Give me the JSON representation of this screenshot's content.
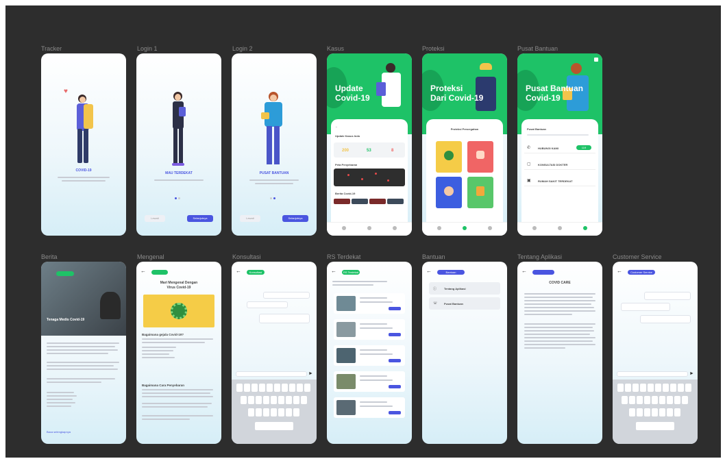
{
  "frames": [
    {
      "id": "tracker",
      "label": "Tracker"
    },
    {
      "id": "login1",
      "label": "Login 1"
    },
    {
      "id": "login2",
      "label": "Login 2"
    },
    {
      "id": "kasus",
      "label": "Kasus"
    },
    {
      "id": "proteksi",
      "label": "Proteksi"
    },
    {
      "id": "pusat-bantuan",
      "label": "Pusat Bantuan"
    },
    {
      "id": "berita",
      "label": "Berita"
    },
    {
      "id": "mengenal",
      "label": "Mengenal"
    },
    {
      "id": "konsultasi",
      "label": "Konsultasi"
    },
    {
      "id": "rs-terdekat",
      "label": "RS Terdekat"
    },
    {
      "id": "bantuan",
      "label": "Bantuan"
    },
    {
      "id": "tentang-aplikasi",
      "label": "Tentang Aplikasi"
    },
    {
      "id": "customer-service",
      "label": "Customer Service"
    }
  ],
  "onboarding": {
    "tracker_title": "COVID-19",
    "login1_title": "MAU TERDEKAT",
    "login2_title": "PUSAT BANTUAN",
    "login_next": "Selanjutnya",
    "login_skip": "Lewati"
  },
  "kasus": {
    "hero": [
      "Update",
      "Covid-19"
    ],
    "stats": [
      "200",
      "53",
      "8"
    ],
    "section1": "Update Kasus Indo",
    "section2": "Peta Penyebaran",
    "section3": "Berita Covid-19"
  },
  "proteksi": {
    "hero": [
      "Proteksi",
      "Dari Covid-19"
    ],
    "card_title": "Proteksi Pencegahan"
  },
  "pusat": {
    "hero": [
      "Pusat Bantuan",
      "Covid-19"
    ],
    "card_title": "Pusat Bantuan",
    "items": [
      "HUBUNGI KAMI",
      "KONSULTASI DOKTER",
      "RUMAH SAKIT TERDEKAT"
    ],
    "hotline": "119"
  },
  "berita": {
    "headline": "Tenaga Medis Covid-19",
    "read_more": "Baca selengkapnya"
  },
  "mengenal": {
    "title": [
      "Mari Mengenal Dengan",
      "Virus Covid-19"
    ],
    "q1": "Bagaimana gejala Covid-19?",
    "q2": "Bagaimana Cara Penyebaran"
  },
  "konsultasi": {
    "badge": "Konsultasi"
  },
  "rs": {
    "badge": "RS Terdekat"
  },
  "bantuan": {
    "badge": "Bantuan",
    "items": [
      "Tentang Aplikasi",
      "Pusat Bantuan"
    ]
  },
  "tentang": {
    "title": "COVID CARE"
  },
  "cs": {
    "badge": "Customer Service"
  },
  "keyboard": {
    "rows": [
      "qwertyuiop",
      "asdfghjkl",
      "zxcvbnm"
    ],
    "space": "space"
  },
  "colors": {
    "canvas": "#2d2d2d",
    "brand_green": "#1ec267",
    "accent_blue": "#4a55e0",
    "tile_yellow": "#f5cc47",
    "tile_red": "#f06565",
    "tile_blue": "#3c5ee0",
    "tile_green": "#58c76a"
  }
}
